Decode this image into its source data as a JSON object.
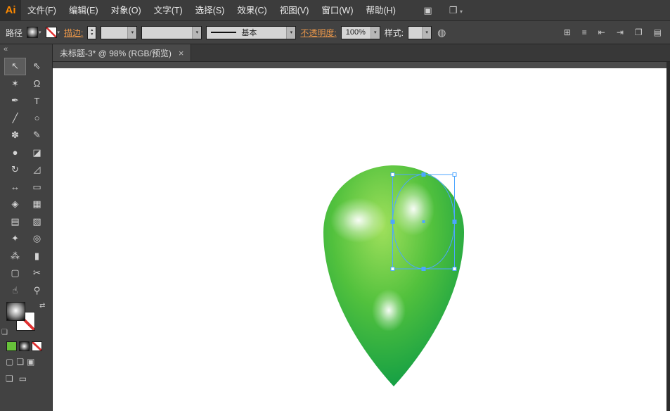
{
  "app": {
    "logo_text": "Ai"
  },
  "menubar": {
    "items": [
      {
        "label": "文件(F)"
      },
      {
        "label": "编辑(E)"
      },
      {
        "label": "对象(O)"
      },
      {
        "label": "文字(T)"
      },
      {
        "label": "选择(S)"
      },
      {
        "label": "效果(C)"
      },
      {
        "label": "视图(V)"
      },
      {
        "label": "窗口(W)"
      },
      {
        "label": "帮助(H)"
      }
    ],
    "bridge_icon": "▣",
    "workspace_icon": "❒",
    "workspace_arrow": "▾"
  },
  "control_bar": {
    "context_label": "路径",
    "fill_arrow": "▾",
    "stroke_arrow": "▾",
    "stroke_link": "描边:",
    "stepper_up": "▲",
    "stepper_down": "▼",
    "width_arrow": "▾",
    "profile_arrow": "▾",
    "brush_label": "基本",
    "brush_arrow": "▾",
    "opacity_link": "不透明度:",
    "opacity_value": "100%",
    "opacity_arrow": "▾",
    "style_label": "样式:",
    "style_arrow": "▾",
    "globe_icon": "◍",
    "right_icons": [
      {
        "name": "transform-panel",
        "glyph": "⊞"
      },
      {
        "name": "align-panel",
        "glyph": "≡"
      },
      {
        "name": "distribute-horizontal",
        "glyph": "⇤"
      },
      {
        "name": "distribute-vertical",
        "glyph": "⇥"
      },
      {
        "name": "arrange-documents",
        "glyph": "❐"
      },
      {
        "name": "document-setup",
        "glyph": "▤"
      }
    ]
  },
  "document_tab": {
    "title": "未标题-3* @ 98% (RGB/预览)",
    "close_glyph": "×"
  },
  "tool_panel": {
    "collapse_glyph": "«",
    "tools": [
      {
        "name": "selection-tool",
        "glyph": "↖"
      },
      {
        "name": "direct-selection-tool",
        "glyph": "⇖"
      },
      {
        "name": "magic-wand-tool",
        "glyph": "✶"
      },
      {
        "name": "lasso-tool",
        "glyph": "Ω"
      },
      {
        "name": "pen-tool",
        "glyph": "✒"
      },
      {
        "name": "type-tool",
        "glyph": "T"
      },
      {
        "name": "line-segment-tool",
        "glyph": "╱"
      },
      {
        "name": "ellipse-tool",
        "glyph": "○"
      },
      {
        "name": "paintbrush-tool",
        "glyph": "✽"
      },
      {
        "name": "pencil-tool",
        "glyph": "✎"
      },
      {
        "name": "blob-brush-tool",
        "glyph": "●"
      },
      {
        "name": "eraser-tool",
        "glyph": "◪"
      },
      {
        "name": "rotate-tool",
        "glyph": "↻"
      },
      {
        "name": "scale-tool",
        "glyph": "◿"
      },
      {
        "name": "width-tool",
        "glyph": "↔"
      },
      {
        "name": "free-transform-tool",
        "glyph": "▭"
      },
      {
        "name": "shape-builder-tool",
        "glyph": "◈"
      },
      {
        "name": "perspective-grid-tool",
        "glyph": "▦"
      },
      {
        "name": "mesh-tool",
        "glyph": "▤"
      },
      {
        "name": "gradient-tool",
        "glyph": "▧"
      },
      {
        "name": "eyedropper-tool",
        "glyph": "✦"
      },
      {
        "name": "blend-tool",
        "glyph": "◎"
      },
      {
        "name": "symbol-sprayer-tool",
        "glyph": "⁂"
      },
      {
        "name": "column-graph-tool",
        "glyph": "▮"
      },
      {
        "name": "artboard-tool",
        "glyph": "▢"
      },
      {
        "name": "slice-tool",
        "glyph": "✂"
      },
      {
        "name": "hand-tool",
        "glyph": "☝"
      },
      {
        "name": "zoom-tool",
        "glyph": "⚲"
      }
    ],
    "swap_glyph": "⇄",
    "default_swatches_glyph": "❏",
    "mode_icons": [
      {
        "name": "draw-normal-mode",
        "glyph": "▢"
      },
      {
        "name": "draw-behind-mode",
        "glyph": "❏"
      },
      {
        "name": "draw-inside-mode",
        "glyph": "▣"
      }
    ],
    "screen_mode_glyph": "❏",
    "screen_mode_glyph2": "▭"
  },
  "colors": {
    "link_orange": "#e8964a",
    "none_red": "#e03131",
    "selection_blue": "#4da6ff",
    "shape_green_light": "#a0e05c",
    "shape_green_mid": "#52c13d",
    "shape_green_dark": "#009447",
    "swatch_green": "#67c23a"
  }
}
